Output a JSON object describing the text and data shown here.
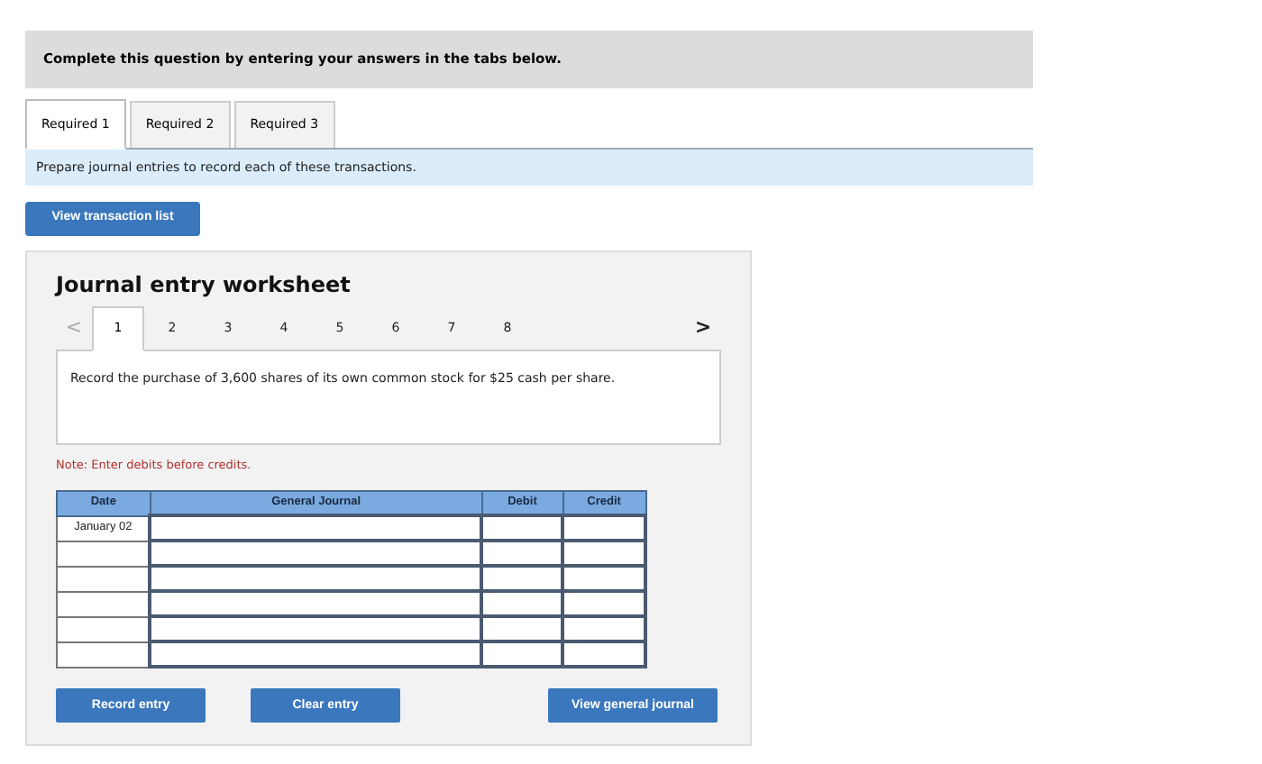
{
  "header": "Complete this question by entering your answers in the tabs below.",
  "tabs": [
    {
      "label": "Required 1",
      "selected": true
    },
    {
      "label": "Required 2",
      "selected": false
    },
    {
      "label": "Required 3",
      "selected": false
    }
  ],
  "instruction": "Prepare journal entries to record each of these transactions.",
  "transaction_button": "View transaction list",
  "worksheet": {
    "title": "Journal entry worksheet",
    "prev": "<",
    "next": ">",
    "steps": [
      {
        "label": "1",
        "selected": true
      },
      {
        "label": "2",
        "selected": false
      },
      {
        "label": "3",
        "selected": false
      },
      {
        "label": "4",
        "selected": false
      },
      {
        "label": "5",
        "selected": false
      },
      {
        "label": "6",
        "selected": false
      },
      {
        "label": "7",
        "selected": false
      },
      {
        "label": "8",
        "selected": false
      }
    ],
    "description": "Record the purchase of 3,600 shares of its own common stock for $25 cash per share.",
    "note": "Note: Enter debits before credits.",
    "table": {
      "columns": [
        "Date",
        "General Journal",
        "Debit",
        "Credit"
      ],
      "rows": [
        {
          "date": "January 02"
        },
        {},
        {},
        {},
        {},
        {}
      ]
    },
    "buttons": [
      "Record entry",
      "Clear entry",
      "View general journal"
    ]
  }
}
